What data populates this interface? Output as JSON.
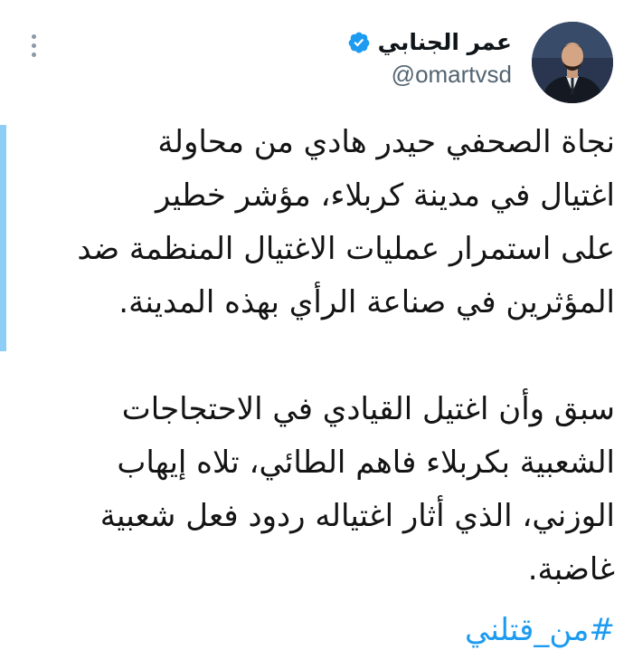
{
  "author": {
    "display_name": "عمر الجنابي",
    "handle": "@omartvsd",
    "verified": true
  },
  "tweet": {
    "paragraph_1_lines": [
      "نجاة الصحفي حيدر هادي من محاولة",
      "اغتيال في مدينة كربلاء، مؤشر خطير",
      "على استمرار عمليات الاغتيال المنظمة ضد",
      "المؤثرين في صناعة الرأي بهذه المدينة."
    ],
    "paragraph_2_lines": [
      "سبق وأن اغتيل القيادي في الاحتجاجات",
      "الشعبية بكربلاء فاهم الطائي، تلاه إيهاب",
      "الوزني، الذي أثار اغتياله ردود فعل شعبية",
      "غاضبة."
    ],
    "hashtag": "#من_قتلني"
  },
  "icons": {
    "verified": "verified-badge-icon",
    "more": "more-options-icon"
  },
  "colors": {
    "link": "#1d9bf0",
    "handle": "#536471",
    "thread_bar": "#8ecdf5",
    "verified": "#1d9bf0"
  }
}
